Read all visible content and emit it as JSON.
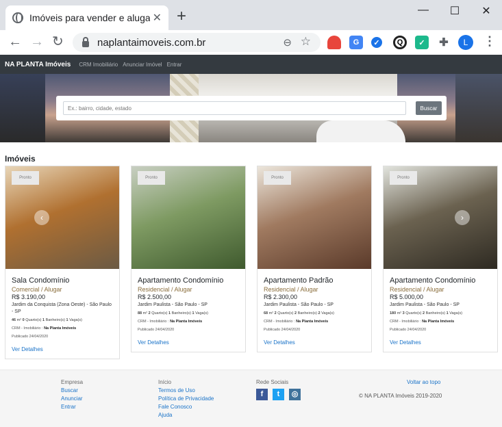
{
  "browser": {
    "tab_title": "Imóveis para vender e alugar | NA",
    "tab_close": "✕",
    "new_tab": "+",
    "minimize": "—",
    "maximize": "☐",
    "close": "✕",
    "back": "←",
    "forward": "→",
    "reload": "↻",
    "url": "naplantaimoveis.com.br",
    "zoom_glyph": "⊖",
    "star_glyph": "☆",
    "profile_initial": "L",
    "menu_glyph": "⋮"
  },
  "nav": {
    "brand": "NA PLANTA Imóveis",
    "links": [
      "CRM Imobiliário",
      "Anunciar Imóvel",
      "Entrar"
    ]
  },
  "hero": {
    "search_placeholder": "Ex.: bairro, cidade, estado",
    "search_button": "Buscar"
  },
  "listings": {
    "section_title": "Imóveis",
    "badge_label": "Pronto",
    "details_label": "Ver Detalhes",
    "items": [
      {
        "title": "Sala Condomínio",
        "category": "Comercial / Alugar",
        "price": "R$ 3.190,00",
        "address": "Jardim da Conquista (Zona Oeste) - São Paulo - SP",
        "area": "46",
        "rooms": "0",
        "baths": "1",
        "parking": "1",
        "crm_prefix": "CRM - Imobiliário :",
        "crm_name": "Na Planta Imóveis",
        "published": "Publicado 24/04/2020",
        "colors": [
          "#6b5a44",
          "#b07030",
          "#e8d6b8"
        ]
      },
      {
        "title": "Apartamento Condomínio",
        "category": "Residencial / Alugar",
        "price": "R$ 2.500,00",
        "address": "Jardim Paulista - São Paulo - SP",
        "area": "88",
        "rooms": "2",
        "baths": "1",
        "parking": "1",
        "crm_prefix": "CRM - Imobiliário :",
        "crm_name": "Na Planta Imóveis",
        "published": "Publicado 24/04/2020",
        "colors": [
          "#3f5a2e",
          "#7e9a62",
          "#c8cfc2"
        ]
      },
      {
        "title": "Apartamento Padrão",
        "category": "Residencial / Alugar",
        "price": "R$ 2.300,00",
        "address": "Jardim Paulista - São Paulo - SP",
        "area": "68",
        "rooms": "2",
        "baths": "2",
        "parking": "2",
        "crm_prefix": "CRM - Imobiliário :",
        "crm_name": "Na Planta Imóveis",
        "published": "Publicado 24/04/2020",
        "colors": [
          "#5a3a2a",
          "#a07a60",
          "#ece6dc"
        ]
      },
      {
        "title": "Apartamento Condomínio",
        "category": "Residencial / Alugar",
        "price": "R$ 5.000,00",
        "address": "Jardim Paulista - São Paulo - SP",
        "area": "180",
        "rooms": "3",
        "baths": "2",
        "parking": "1",
        "crm_prefix": "CRM - Imobiliário :",
        "crm_name": "Na Planta Imóveis",
        "published": "Publicado 24/04/2020",
        "colors": [
          "#2e2a22",
          "#6b6250",
          "#e2e4de"
        ]
      }
    ],
    "feature_labels": {
      "area_unit": "m²",
      "rooms": "Quarto(s)",
      "baths": "Banheiro(s)",
      "parking": "Vaga(s)"
    }
  },
  "footer": {
    "col1": {
      "heading": "Empresa",
      "links": [
        "Buscar",
        "Anunciar",
        "Entrar"
      ]
    },
    "col2": {
      "heading": "Início",
      "links": [
        "Termos de Uso",
        "Política de Privacidade",
        "Fale Conosco",
        "Ajuda"
      ]
    },
    "col3": {
      "heading": "Rede Sociais",
      "icons": [
        "facebook-icon",
        "twitter-icon",
        "instagram-icon"
      ]
    },
    "back_to_top": "Voltar ao topo",
    "copyright": "© NA PLANTA Imóveis 2019-2020"
  }
}
